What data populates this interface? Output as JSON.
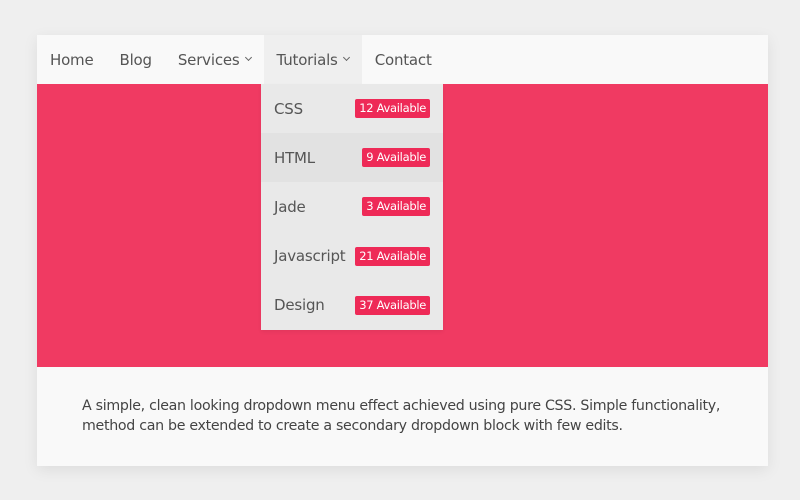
{
  "nav": {
    "items": [
      {
        "label": "Home",
        "has_dropdown": false
      },
      {
        "label": "Blog",
        "has_dropdown": false
      },
      {
        "label": "Services",
        "has_dropdown": true
      },
      {
        "label": "Tutorials",
        "has_dropdown": true,
        "active": true
      },
      {
        "label": "Contact",
        "has_dropdown": false
      }
    ]
  },
  "dropdown": {
    "items": [
      {
        "label": "CSS",
        "badge": "12 Available"
      },
      {
        "label": "HTML",
        "badge": "9 Available",
        "hovered": true
      },
      {
        "label": "Jade",
        "badge": "3 Available"
      },
      {
        "label": "Javascript",
        "badge": "21 Available"
      },
      {
        "label": "Design",
        "badge": "37 Available"
      }
    ]
  },
  "description": "A simple, clean looking dropdown menu effect achieved using pure CSS. Simple functionality, method can be extended to create a secondary dropdown block with few edits.",
  "colors": {
    "accent": "#f03a62",
    "badge": "#ee2a57",
    "background": "#efefef",
    "card": "#f9f9f9",
    "dropdown": "#e9e9e9"
  }
}
